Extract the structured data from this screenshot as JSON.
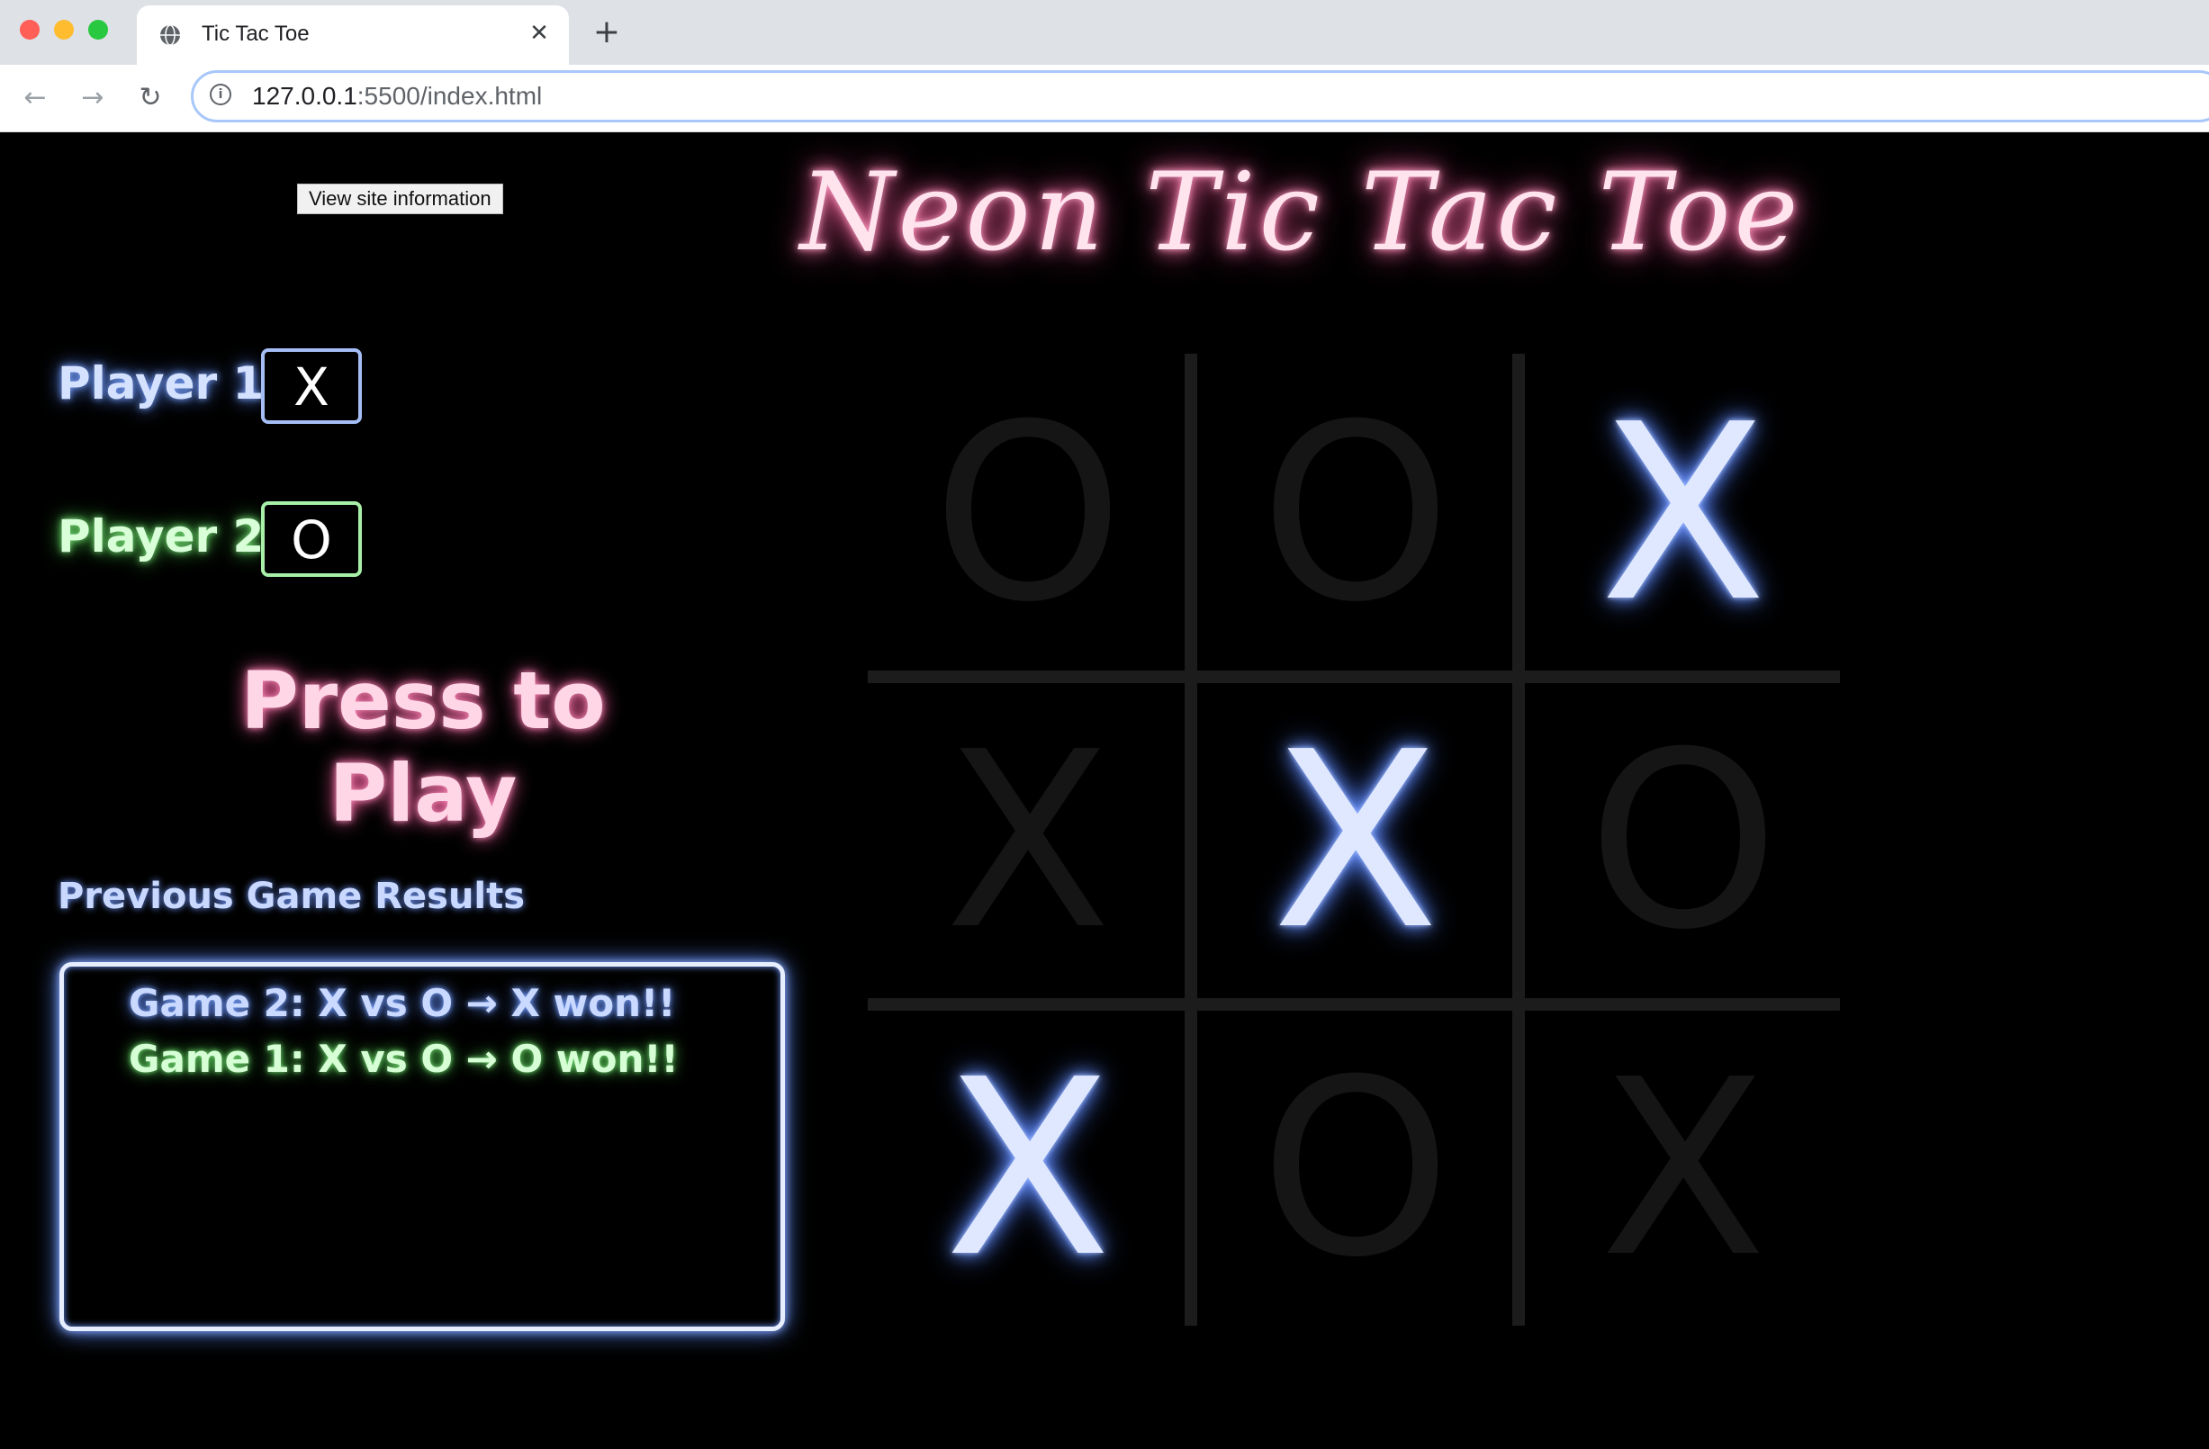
{
  "browser": {
    "tab_title": "Tic Tac Toe",
    "tab_close": "✕",
    "new_tab": "+",
    "url_host": "127.0.0.1",
    "url_path": ":5500/index.html",
    "back": "←",
    "forward": "→",
    "reload": "↻",
    "site_info": "i"
  },
  "tooltip": "View site information",
  "page": {
    "title": "Neon Tic Tac Toe",
    "player1": {
      "label": "Player 1",
      "symbol": "X"
    },
    "player2": {
      "label": "Player 2",
      "symbol": "O"
    },
    "play_button": "Press to Play",
    "results_heading": "Previous Game Results",
    "results": [
      "Game 2: X vs O → X won!!",
      "Game 1: X vs O → O won!!"
    ]
  },
  "board": {
    "cells": [
      "O",
      "O",
      "X",
      "X",
      "X",
      "O",
      "X",
      "O",
      "X"
    ],
    "highlighted": [
      false,
      false,
      true,
      false,
      true,
      false,
      true,
      false,
      false
    ]
  },
  "colors": {
    "title_glow": "#ff4f95",
    "player1_glow": "#5e8cff",
    "player2_glow": "#4fd04f",
    "background": "#000000"
  }
}
